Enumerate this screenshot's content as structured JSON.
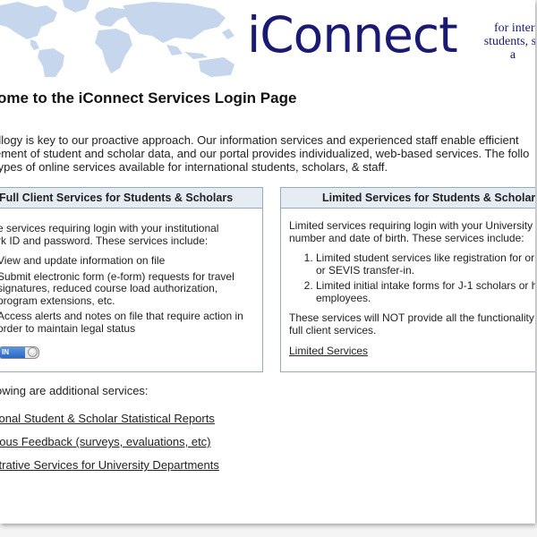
{
  "header": {
    "logo": "iConnect",
    "tagline": [
      "for intern",
      "students, sc",
      "a"
    ]
  },
  "page_title": "ome to the iConnect Services Login Page",
  "intro": [
    "dlogy is key to our proactive approach. Our information services and experienced staff enable efficient",
    "ement of student and scholar data, and our portal provides individualized, web-based services. The follo",
    " types of online services available for international students, scholars, & staff."
  ],
  "full_panel": {
    "title": "Full Client Services for Students & Scholars",
    "desc": [
      "e services requiring login with your institutional",
      "rk ID and password. These services include:"
    ],
    "items": [
      [
        "View and update information on file"
      ],
      [
        "Submit electronic form (e-form) requests for travel",
        "signatures, reduced course load authorization,",
        "program extensions, etc."
      ],
      [
        "Access alerts and notes on file that require action in",
        "order to maintain legal status"
      ]
    ],
    "login_button": "IN"
  },
  "limited_panel": {
    "title": "Limited Services for Students & Scholars",
    "desc": [
      "Limited services requiring login with your University",
      "number and date of birth. These services include:"
    ],
    "items": [
      [
        "Limited student services like registration for or",
        "or SEVIS transfer-in."
      ],
      [
        "Limited initial intake forms for J-1 scholars or h",
        "employees."
      ]
    ],
    "note": [
      "These services will NOT provide all the functionality",
      "full client services."
    ],
    "link": "Limited Services"
  },
  "additional_label": "owing are additional services:",
  "additional_links": [
    "tional Student & Scholar Statistical Reports",
    "nous Feedback (surveys, evaluations, etc)",
    "strative Services for University Departments"
  ],
  "colors": {
    "brand": "#1a1a72",
    "map": "#c6d6ec",
    "panel_header": "#e6ecf4",
    "panel_border": "#98aabf"
  }
}
